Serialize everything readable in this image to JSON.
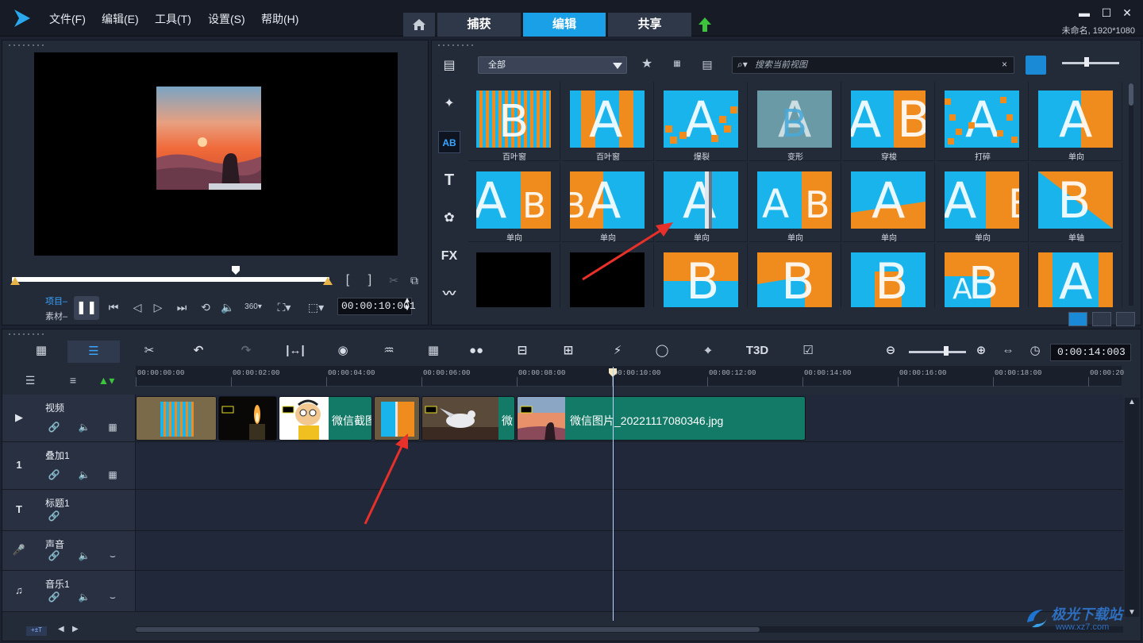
{
  "menu": {
    "file": "文件(F)",
    "edit": "编辑(E)",
    "tools": "工具(T)",
    "settings": "设置(S)",
    "help": "帮助(H)"
  },
  "tabs": {
    "capture": "捕获",
    "edit": "编辑",
    "share": "共享",
    "active": "edit"
  },
  "window": {
    "minimize": "▬",
    "maximize": "☐",
    "close": "✕",
    "project_info": "未命名, 1920*1080"
  },
  "preview": {
    "mode_project": "项目",
    "mode_clip": "素材",
    "timecode": "00:00:10:001",
    "scrub_position": 0.7,
    "bracket_in": "[",
    "bracket_out": "]"
  },
  "library": {
    "category": "全部",
    "search_placeholder": "搜索当前视图",
    "search_value": "",
    "sidebar": [
      "media",
      "instant-project",
      "transition",
      "title",
      "graphics",
      "filter",
      "path"
    ],
    "sidebar_fx_label": "FX",
    "sidebar_title_label": "T",
    "sidebar_transition_label": "AB",
    "transitions": [
      {
        "label": "百叶窗",
        "style": "blinds-vertical"
      },
      {
        "label": "百叶窗",
        "style": "blinds-split"
      },
      {
        "label": "爆裂",
        "style": "burst"
      },
      {
        "label": "变形",
        "style": "morph"
      },
      {
        "label": "穿梭",
        "style": "shuttle"
      },
      {
        "label": "打碎",
        "style": "shatter"
      },
      {
        "label": "单向",
        "style": "oneway-a"
      },
      {
        "label": "单向",
        "style": "oneway-b"
      },
      {
        "label": "单向",
        "style": "oneway-c"
      },
      {
        "label": "单向",
        "style": "oneway-d"
      },
      {
        "label": "单向",
        "style": "oneway-e"
      },
      {
        "label": "单向",
        "style": "oneway-f"
      },
      {
        "label": "单向",
        "style": "oneway-g"
      },
      {
        "label": "单轴",
        "style": "single-axis"
      },
      {
        "label": "",
        "style": "black"
      },
      {
        "label": "",
        "style": "black"
      },
      {
        "label": "",
        "style": "row3-a"
      },
      {
        "label": "",
        "style": "row3-b"
      },
      {
        "label": "",
        "style": "row3-c"
      },
      {
        "label": "",
        "style": "row3-d"
      },
      {
        "label": "",
        "style": "row3-e"
      }
    ],
    "thumb_letter_a": "A",
    "thumb_letter_b": "B"
  },
  "timeline": {
    "duration": "0:00:14:003",
    "ruler_labels": [
      "00:00:00:00",
      "00:00:02:00",
      "00:00:04:00",
      "00:00:06:00",
      "00:00:08:00",
      "00:00:10:00",
      "00:00:12:00",
      "00:00:14:00",
      "00:00:16:00",
      "00:00:18:00",
      "00:00:20"
    ],
    "tracks": [
      {
        "name": "视频",
        "icon": "video-track-icon"
      },
      {
        "name": "叠加1",
        "icon": "overlay-track-icon"
      },
      {
        "name": "标题1",
        "icon": "title-track-icon"
      },
      {
        "name": "声音",
        "icon": "voice-track-icon"
      },
      {
        "name": "音乐1",
        "icon": "music-track-icon"
      }
    ],
    "clips": {
      "clip3_label": "微信截图",
      "clip5_label": "微",
      "clip6_label": "微信图片_20221117080346.jpg"
    },
    "bottom_label": "+±T"
  },
  "watermark": {
    "title": "极光下载站",
    "url": "www.xz7.com"
  },
  "colors": {
    "accent": "#1aa0e6",
    "clip_green": "#127a66",
    "transition_blue": "#1ab4ec",
    "transition_orange": "#f08c1e",
    "annotation_red": "#e8302a"
  }
}
